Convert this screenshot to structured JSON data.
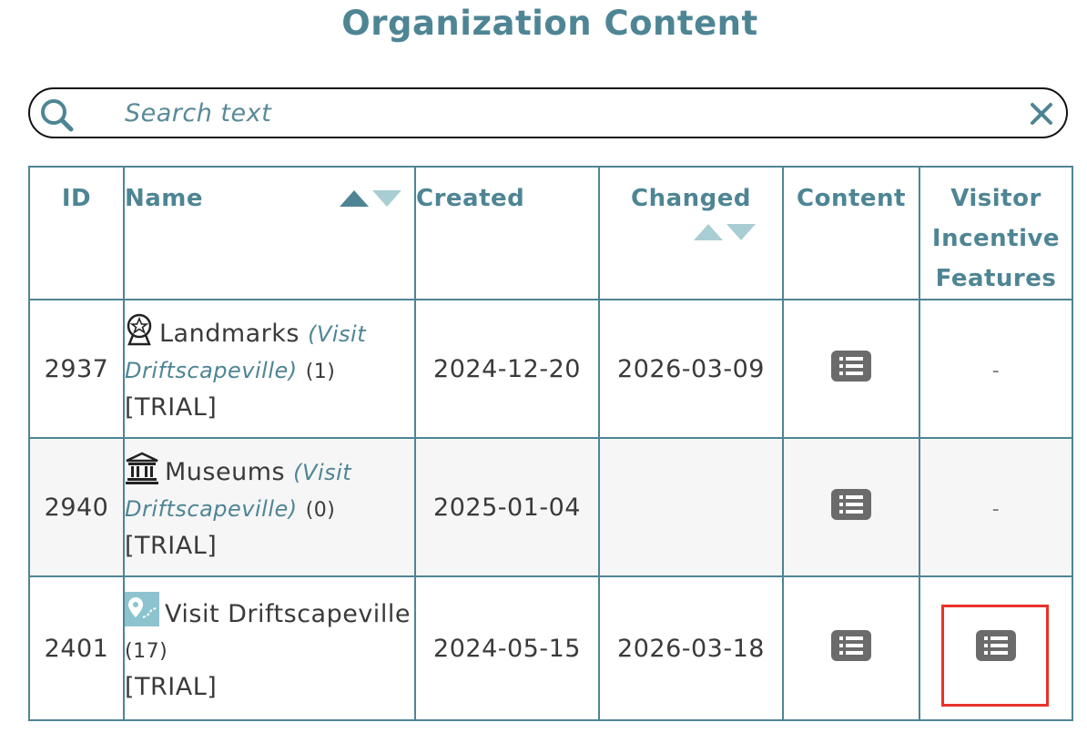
{
  "page_title": "Organization Content",
  "search": {
    "placeholder": "Search text",
    "value": ""
  },
  "columns": {
    "id": "ID",
    "name": "Name",
    "created": "Created",
    "changed": "Changed",
    "content": "Content",
    "visitor_incentive_features": "Visitor Incentive Features"
  },
  "rows": [
    {
      "id": "2937",
      "icon": "landmark-badge-icon",
      "name": "Landmarks",
      "parent_link": "(Visit Driftscapeville)",
      "count": "(1)",
      "status": "[TRIAL]",
      "created": "2024-12-20",
      "changed": "2026-03-09",
      "content_icon": "list-icon",
      "visitor_incentive": "-"
    },
    {
      "id": "2940",
      "icon": "museum-building-icon",
      "name": "Museums",
      "parent_link": "(Visit Driftscapeville)",
      "count": "(0)",
      "status": "[TRIAL]",
      "created": "2025-01-04",
      "changed": "",
      "content_icon": "list-icon",
      "visitor_incentive": "-"
    },
    {
      "id": "2401",
      "icon": "map-pin-route-icon",
      "name": "Visit Driftscapeville",
      "parent_link": "",
      "count": "(17)",
      "status": "[TRIAL]",
      "created": "2024-05-15",
      "changed": "2026-03-18",
      "content_icon": "list-icon",
      "visitor_incentive_icon": "list-icon"
    }
  ],
  "colors": {
    "accent": "#4e8594",
    "sort_arrow_active": "#4e8594",
    "sort_arrow_inactive": "#a8cdd3",
    "list_button": "#6b6b6b",
    "highlight": "#e8322b",
    "alt_row": "#f6f6f6"
  }
}
